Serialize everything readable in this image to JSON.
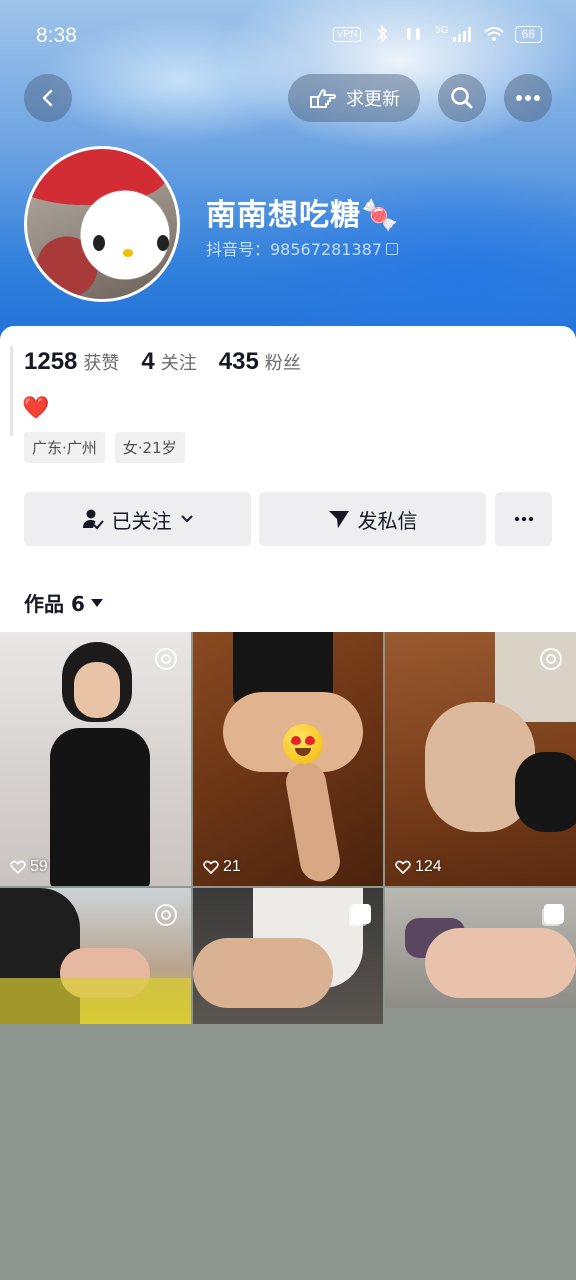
{
  "status_bar": {
    "time": "8:38",
    "vpn": "VPN",
    "network": "5G",
    "battery": "68"
  },
  "top_bar": {
    "request_update_label": "求更新"
  },
  "profile": {
    "name": "南南想吃糖🍬",
    "douyin_id": "抖音号：98567281387",
    "stats": [
      {
        "value": "1258",
        "label": "获赞"
      },
      {
        "value": "4",
        "label": "关注"
      },
      {
        "value": "435",
        "label": "粉丝"
      }
    ],
    "bio": "❤️",
    "tags": [
      "广东·广州",
      "女·21岁"
    ]
  },
  "actions": {
    "followed_label": "已关注",
    "message_label": "发私信"
  },
  "works_tab": {
    "label": "作品 6"
  },
  "works": [
    {
      "likes": "59",
      "badge": "live"
    },
    {
      "likes": "21",
      "badge": "none"
    },
    {
      "likes": "124",
      "badge": "live"
    },
    {
      "likes": "",
      "badge": "live"
    },
    {
      "likes": "",
      "badge": "multi"
    },
    {
      "likes": "",
      "badge": "multi"
    }
  ],
  "colors": {
    "header_blue": "#2f7fdc",
    "like_red": "#e8232b",
    "empty_area": "#8e9690"
  }
}
